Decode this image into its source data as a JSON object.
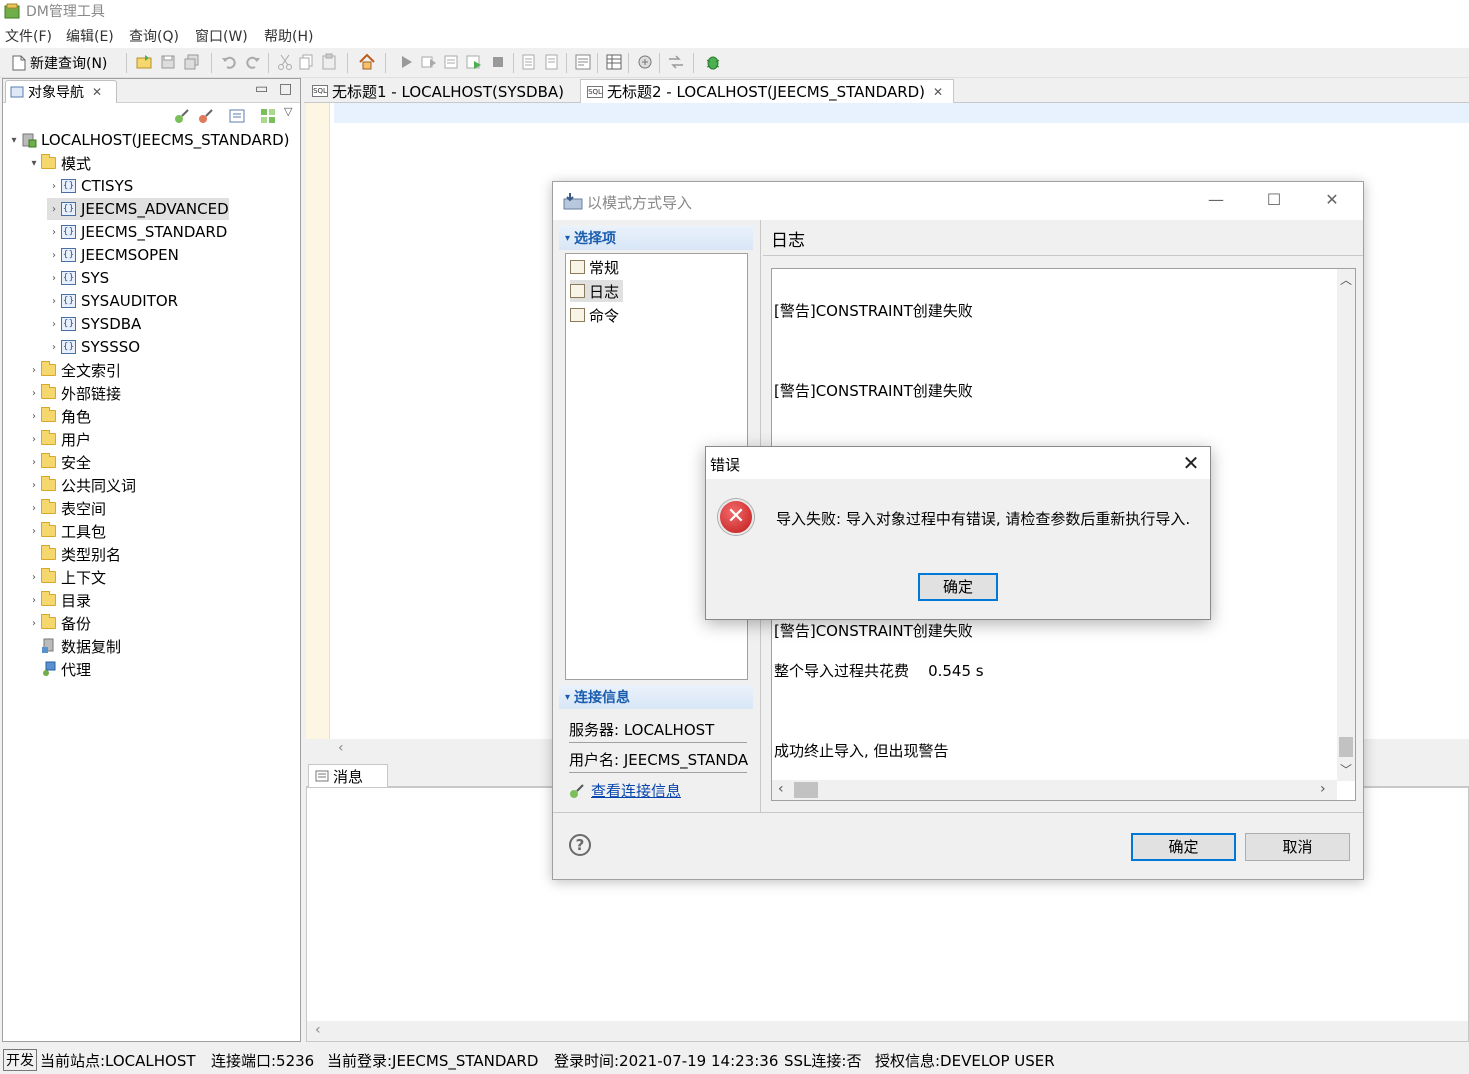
{
  "window": {
    "title": "DM管理工具"
  },
  "menu": [
    "文件(F)",
    "编辑(E)",
    "查询(Q)",
    "窗口(W)",
    "帮助(H)"
  ],
  "toolbar": {
    "new_query": "新建查询(N)"
  },
  "nav": {
    "tab_label": "对象导航",
    "root": "LOCALHOST(JEECMS_STANDARD)",
    "schema_folder": "模式",
    "schemas": [
      "CTISYS",
      "JEECMS_ADVANCED",
      "JEECMS_STANDARD",
      "JEECMSOPEN",
      "SYS",
      "SYSAUDITOR",
      "SYSDBA",
      "SYSSSO"
    ],
    "selected_schema": "JEECMS_ADVANCED",
    "folders": [
      "全文索引",
      "外部链接",
      "角色",
      "用户",
      "安全",
      "公共同义词",
      "表空间",
      "工具包",
      "类型别名",
      "上下文",
      "目录",
      "备份",
      "数据复制",
      "代理"
    ]
  },
  "editor": {
    "tabs": [
      "无标题1 - LOCALHOST(SYSDBA)",
      "无标题2 - LOCALHOST(JEECMS_STANDARD)"
    ],
    "active_tab": 1
  },
  "messages": {
    "tab_label": "消息"
  },
  "status": {
    "mode": "开发",
    "site": "当前站点:LOCALHOST",
    "port": "连接端口:5236",
    "login": "当前登录:JEECMS_STANDARD",
    "login_time": "登录时间:2021-07-19 14:23:36",
    "ssl": "SSL连接:否",
    "license": "授权信息:DEVELOP USER"
  },
  "import_dialog": {
    "title": "以模式方式导入",
    "options_header": "选择项",
    "options": [
      "常规",
      "日志",
      "命令"
    ],
    "selected_option": "日志",
    "conn_header": "连接信息",
    "server": "服务器: LOCALHOST",
    "user": "用户名: JEECMS_STANDA",
    "view_conn_link": "查看连接信息",
    "log_title": "日志",
    "log_lines": [
      "[警告]CONSTRAINT创建失败",
      "[警告]CONSTRAINT创建失败",
      "[警告]CONSTRAINT创建失败",
      "整个导入过程共花费    0.545 s",
      "成功终止导入, 但出现警告"
    ],
    "ok": "确定",
    "cancel": "取消",
    "help": "?"
  },
  "error_dialog": {
    "title": "错误",
    "message": "导入失败: 导入对象过程中有错误, 请检查参数后重新执行导入.",
    "ok": "确定"
  }
}
